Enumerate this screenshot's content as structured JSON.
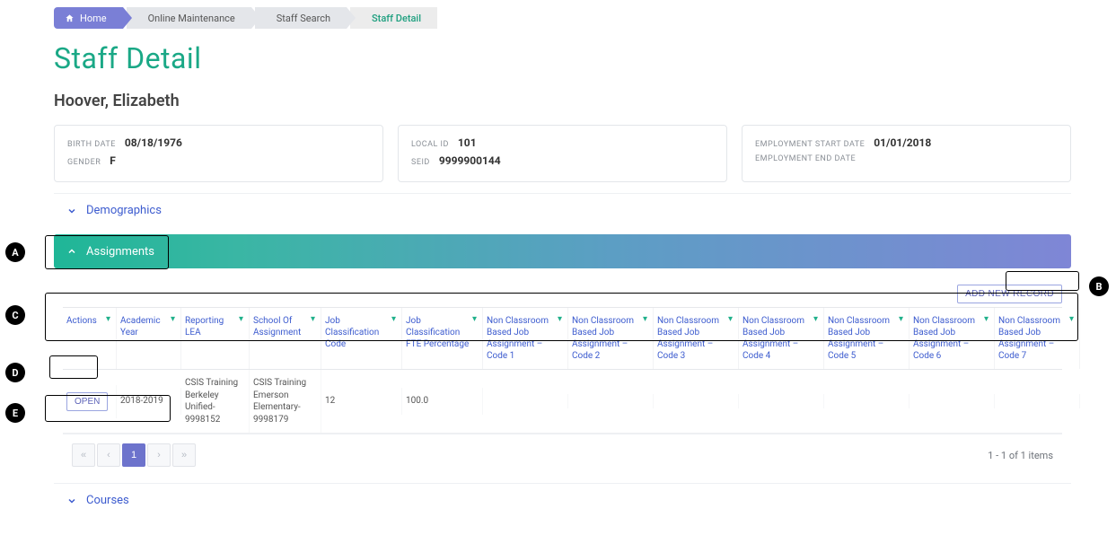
{
  "breadcrumb": {
    "home": "Home",
    "online_maintenance": "Online Maintenance",
    "staff_search": "Staff Search",
    "staff_detail": "Staff Detail"
  },
  "page_title": "Staff Detail",
  "staff_name": "Hoover, Elizabeth",
  "details": {
    "birth_date_label": "BIRTH DATE",
    "birth_date": "08/18/1976",
    "gender_label": "GENDER",
    "gender": "F",
    "local_id_label": "LOCAL ID",
    "local_id": "101",
    "seid_label": "SEID",
    "seid": "9999900144",
    "emp_start_label": "EMPLOYMENT START DATE",
    "emp_start": "01/01/2018",
    "emp_end_label": "EMPLOYMENT END DATE",
    "emp_end": ""
  },
  "sections": {
    "demographics": "Demographics",
    "assignments": "Assignments",
    "courses": "Courses"
  },
  "toolbar": {
    "add_new_record": "ADD NEW RECORD"
  },
  "grid": {
    "headers": {
      "actions": "Actions",
      "academic_year": "Academic Year",
      "reporting_lea": "Reporting LEA",
      "school_of_assignment": "School Of Assignment",
      "job_class_code": "Job Classification Code",
      "job_class_fte": "Job Classification FTE Percentage",
      "ncba1": "Non Classroom Based Job Assignment – Code 1",
      "ncba2": "Non Classroom Based Job Assignment – Code 2",
      "ncba3": "Non Classroom Based Job Assignment – Code 3",
      "ncba4": "Non Classroom Based Job Assignment – Code 4",
      "ncba5": "Non Classroom Based Job Assignment – Code 5",
      "ncba6": "Non Classroom Based Job Assignment – Code 6",
      "ncba7": "Non Classroom Based Job Assignment – Code 7"
    },
    "row_open_label": "OPEN",
    "rows": [
      {
        "academic_year": "2018-2019",
        "reporting_lea": "CSIS Training Berkeley Unified-9998152",
        "school_of_assignment": "CSIS Training Emerson Elementary-9998179",
        "job_class_code": "12",
        "job_class_fte": "100.0",
        "ncba1": "",
        "ncba2": "",
        "ncba3": "",
        "ncba4": "",
        "ncba5": "",
        "ncba6": "",
        "ncba7": ""
      }
    ]
  },
  "pager": {
    "first": "«",
    "prev": "‹",
    "page": "1",
    "next": "›",
    "last": "»",
    "status": "1 - 1 of 1 items"
  },
  "callouts": {
    "A": "A",
    "B": "B",
    "C": "C",
    "D": "D",
    "E": "E"
  }
}
